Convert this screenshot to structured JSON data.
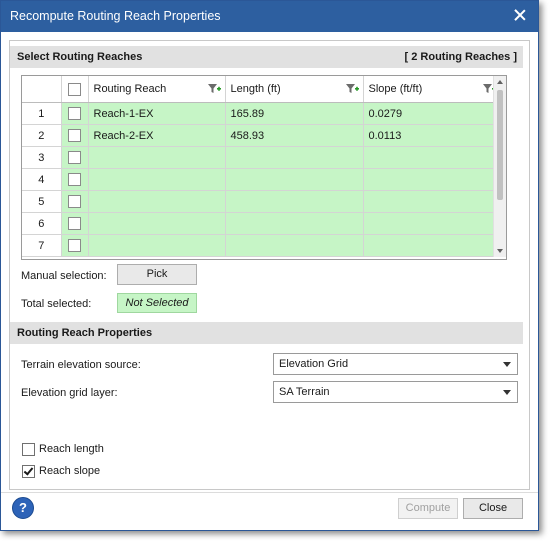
{
  "window": {
    "title": "Recompute Routing Reach Properties"
  },
  "select_section": {
    "title": "Select Routing Reaches",
    "count": "[ 2 Routing Reaches ]",
    "columns": [
      "Routing Reach",
      "Length (ft)",
      "Slope (ft/ft)"
    ],
    "rows": [
      {
        "num": "1",
        "reach": "Reach-1-EX",
        "length": "165.89",
        "slope": "0.0279"
      },
      {
        "num": "2",
        "reach": "Reach-2-EX",
        "length": "458.93",
        "slope": "0.0113"
      },
      {
        "num": "3",
        "reach": "",
        "length": "",
        "slope": ""
      },
      {
        "num": "4",
        "reach": "",
        "length": "",
        "slope": ""
      },
      {
        "num": "5",
        "reach": "",
        "length": "",
        "slope": ""
      },
      {
        "num": "6",
        "reach": "",
        "length": "",
        "slope": ""
      },
      {
        "num": "7",
        "reach": "",
        "length": "",
        "slope": ""
      }
    ],
    "manual_selection_label": "Manual selection:",
    "pick_label": "Pick",
    "total_selected_label": "Total selected:",
    "total_selected_value": "Not Selected"
  },
  "props_section": {
    "title": "Routing Reach Properties",
    "terrain_label": "Terrain elevation source:",
    "terrain_value": "Elevation Grid",
    "grid_layer_label": "Elevation grid layer:",
    "grid_layer_value": "SA Terrain",
    "reach_length_label": "Reach length",
    "reach_length_checked": false,
    "reach_slope_label": "Reach slope",
    "reach_slope_checked": true
  },
  "footer": {
    "help": "?",
    "compute_label": "Compute",
    "close_label": "Close"
  },
  "colors": {
    "title_bar": "#2d5fa0",
    "selected_row": "#c6f5c6",
    "section_header": "#e1e1e1"
  }
}
